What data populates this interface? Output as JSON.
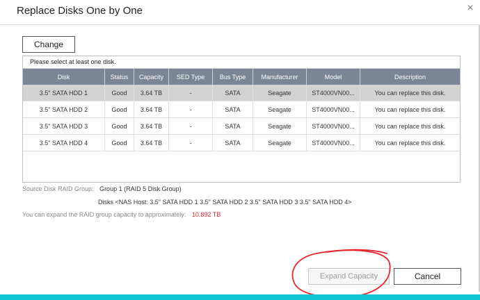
{
  "dialog": {
    "title": "Replace Disks One by One",
    "close_symbol": "×"
  },
  "toolbar": {
    "change_label": "Change"
  },
  "table": {
    "note": "Please select at least one disk.",
    "headers": [
      "Disk",
      "Status",
      "Capacity",
      "SED Type",
      "Bus Type",
      "Manufacturer",
      "Model",
      "Description"
    ],
    "rows": [
      [
        "3.5\" SATA HDD 1",
        "Good",
        "3.64 TB",
        "-",
        "SATA",
        "Seagate",
        "ST4000VN00...",
        "You can replace this disk."
      ],
      [
        "3.5\" SATA HDD 2",
        "Good",
        "3.64 TB",
        "-",
        "SATA",
        "Seagate",
        "ST4000VN00...",
        "You can replace this disk."
      ],
      [
        "3.5\" SATA HDD 3",
        "Good",
        "3.64 TB",
        "-",
        "SATA",
        "Seagate",
        "ST4000VN00...",
        "You can replace this disk."
      ],
      [
        "3.5\" SATA HDD 4",
        "Good",
        "3.64 TB",
        "-",
        "SATA",
        "Seagate",
        "ST4000VN00...",
        "You can replace this disk."
      ]
    ]
  },
  "info": {
    "source_label": "Source Disk RAID Group:",
    "source_value": "Group 1 (RAID 5 Disk Group)",
    "disks_text": "Disks <NAS Host: 3.5\" SATA HDD 1 3.5\" SATA HDD 2 3.5\" SATA HDD 3 3.5\" SATA HDD 4>",
    "expand_label": "You can expand the RAID group capacity to approximately:",
    "expand_value": "10.892 TB"
  },
  "footer": {
    "expand_label": "Expand Capacity",
    "cancel_label": "Cancel"
  },
  "colors": {
    "header_bg": "#7a8596",
    "selected_row": "#d2d2d2",
    "highlight_red": "#e0262a",
    "annotation_red": "#e8242b",
    "taskbar": "#12c7d4"
  }
}
